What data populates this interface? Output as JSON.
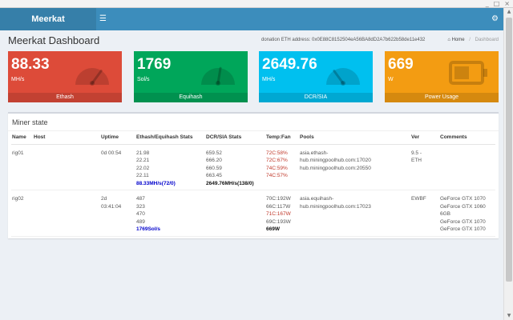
{
  "window": {
    "controls": [
      "_",
      "□",
      "×"
    ]
  },
  "navbar": {
    "brand": "Meerkat",
    "menu_icon": "☰",
    "settings_icon": "⚙"
  },
  "header": {
    "title": "Meerkat Dashboard",
    "donation": "donation ETH address: 0x0E88C8152504eA56BA8dD2A7b622b58de11e432",
    "breadcrumb": {
      "home_icon": "⌂",
      "home": "Home",
      "separator": "/",
      "current": "Dashboard"
    }
  },
  "boxes": [
    {
      "value": "88.33",
      "unit": "MH/s",
      "footer": "Ethash",
      "color": "#dd4b39",
      "icon": "speedometer-icon",
      "gauge_level": 0.7
    },
    {
      "value": "1769",
      "unit": "Sol/s",
      "footer": "Equihash",
      "color": "#00a65a",
      "icon": "speedometer-icon",
      "gauge_level": 0.55
    },
    {
      "value": "2649.76",
      "unit": "MH/s",
      "footer": "DCR/SIA",
      "color": "#00c0ef",
      "icon": "speedometer-icon",
      "gauge_level": 0.3
    },
    {
      "value": "669",
      "unit": "W",
      "footer": "Power Usage",
      "color": "#f39c12",
      "icon": "battery-icon",
      "gauge_level": 0.6
    }
  ],
  "miner_panel": {
    "title": "Miner state",
    "columns": [
      "Name",
      "Host",
      "Uptime",
      "Ethash/Equihash Stats",
      "DCR/SIA Stats",
      "Temp:Fan",
      "Pools",
      "Ver",
      "Comments"
    ],
    "rows": [
      {
        "name": "rig01",
        "host": "",
        "uptime": [
          "0d 00:54"
        ],
        "ethash": [
          "21.98",
          "22.21",
          "22.02",
          "22.11"
        ],
        "ethash_total": "88.33MH/s(72/0)",
        "ethash_total_style": "blue",
        "dcr": [
          "659.52",
          "666.20",
          "660.59",
          "663.45"
        ],
        "dcr_total": "2649.76MH/s(138/0)",
        "temps": [
          {
            "text": "72C:58%",
            "hot": true
          },
          {
            "text": "72C:67%",
            "hot": true
          },
          {
            "text": "74C:59%",
            "hot": true
          },
          {
            "text": "74C:57%",
            "hot": true
          }
        ],
        "temp_total": "",
        "pools": [
          "asia.ethash-",
          "hub.miningpoolhub.com:17020",
          "hub.miningpoolhub.com:20550"
        ],
        "ver": [
          "9.5 -",
          "ETH"
        ],
        "comments": []
      },
      {
        "name": "rig02",
        "host": "",
        "uptime": [
          "2d",
          "03:41:04"
        ],
        "ethash": [
          "487",
          "323",
          "470",
          "489"
        ],
        "ethash_total": "1769Sol/s",
        "ethash_total_style": "blue",
        "dcr": [],
        "dcr_total": "",
        "temps": [
          {
            "text": "70C:192W",
            "hot": false
          },
          {
            "text": "66C:117W",
            "hot": false
          },
          {
            "text": "71C:167W",
            "hot": true
          },
          {
            "text": "69C:193W",
            "hot": false
          }
        ],
        "temp_total": "669W",
        "pools": [
          "asia.equihash-",
          "hub.miningpoolhub.com:17023"
        ],
        "ver": [
          "EWBF"
        ],
        "comments": [
          "GeForce GTX 1070",
          "GeForce GTX 1060",
          "6GB",
          "GeForce GTX 1070",
          "GeForce GTX 1070"
        ]
      }
    ]
  }
}
